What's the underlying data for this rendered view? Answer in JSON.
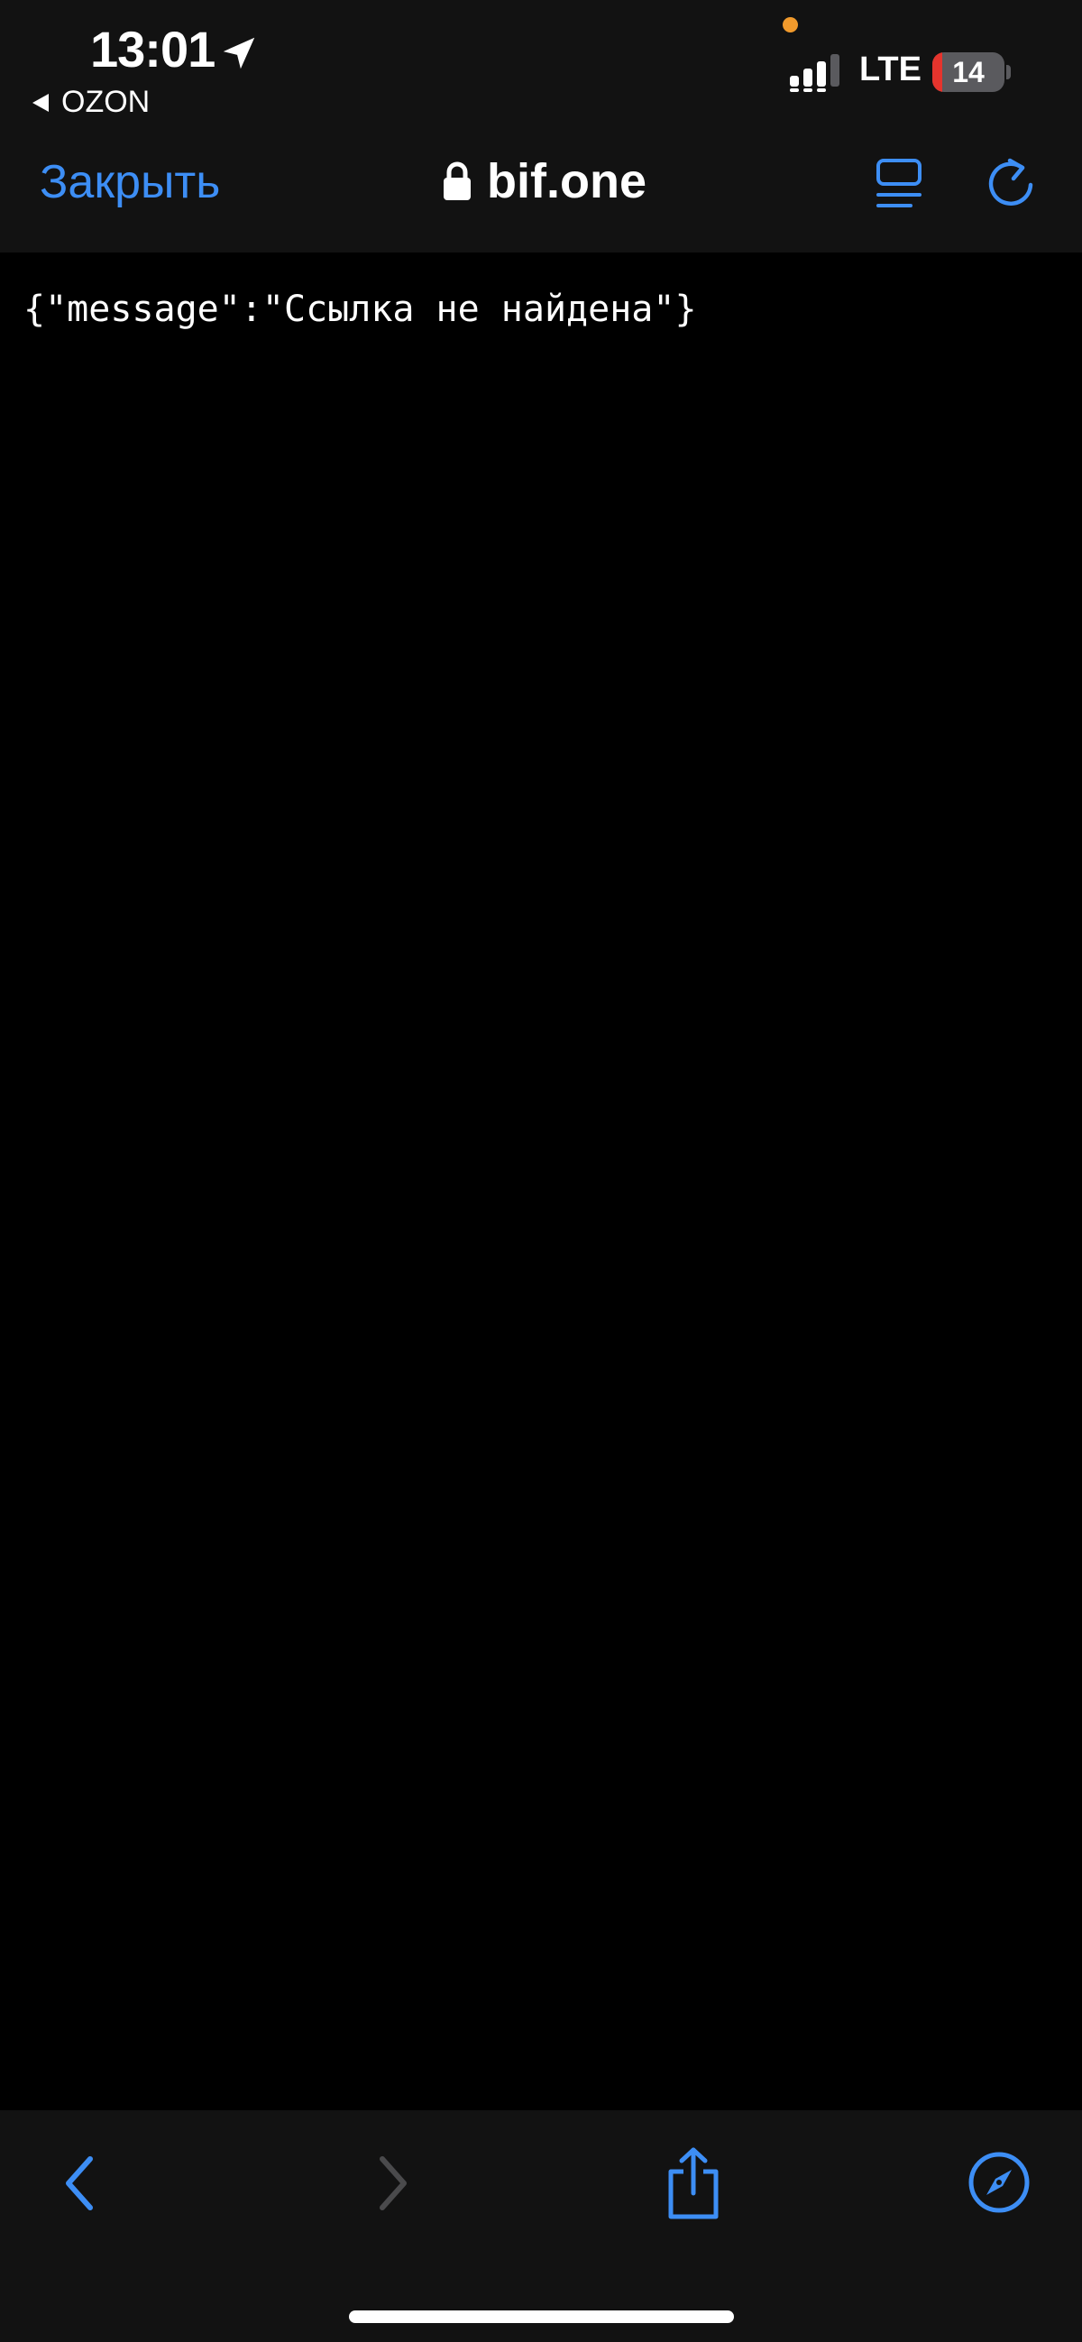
{
  "status_bar": {
    "time": "13:01",
    "back_app": "OZON",
    "network": "LTE",
    "battery_level": "14",
    "battery_fraction": 0.14,
    "icons": [
      "location-arrow-icon",
      "signal-icon",
      "battery-icon"
    ]
  },
  "browser_bar": {
    "close_label": "Закрыть",
    "url": "bif.one",
    "icons": [
      "lock-icon",
      "reader-view-icon",
      "reload-icon"
    ]
  },
  "page": {
    "body_text": "{\"message\":\"Ссылка не найдена\"}"
  },
  "toolbar": {
    "icons": [
      "back-arrow-icon",
      "forward-arrow-icon",
      "share-icon",
      "safari-compass-icon"
    ],
    "forward_enabled": false
  },
  "colors": {
    "accent": "#3d8ef5",
    "background": "#000000",
    "bar_background": "#121212",
    "text": "#ffffff",
    "disabled": "#4a4a4c",
    "battery_low": "#e5342d",
    "orange_indicator": "#f19a2c"
  }
}
